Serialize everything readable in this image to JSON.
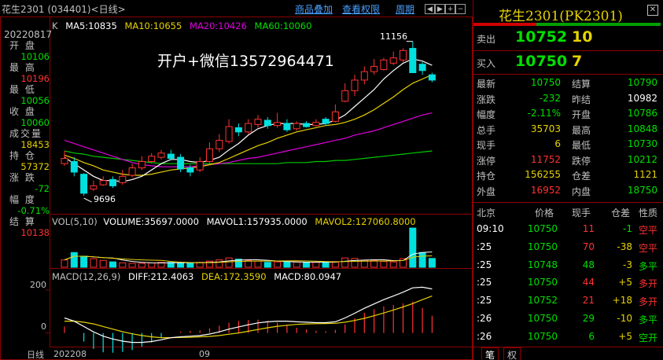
{
  "header": {
    "title": "花生2301 (034401)<日线>",
    "menu": [
      "商品叠加",
      "查看权限",
      "周期"
    ]
  },
  "left_info": {
    "date": "20220817",
    "rows": [
      {
        "label": "开 盘",
        "value": "10106",
        "color": "#00e000"
      },
      {
        "label": "最 高",
        "value": "10196",
        "color": "#ff3232"
      },
      {
        "label": "最 低",
        "value": "10056",
        "color": "#00e000"
      },
      {
        "label": "收 盘",
        "value": "10060",
        "color": "#00e000"
      },
      {
        "label": "成交量",
        "value": "18453",
        "color": "#e7d200"
      },
      {
        "label": "持 仓",
        "value": "57372",
        "color": "#e7d200"
      },
      {
        "label": "涨 跌",
        "value": "-72",
        "color": "#00e000"
      },
      {
        "label": "幅 度",
        "value": "-0.71%",
        "color": "#00e000"
      },
      {
        "label": "结 算",
        "value": "10138",
        "color": "#ff3232"
      }
    ]
  },
  "kline": {
    "label": "K",
    "ma5": "MA5:10835",
    "ma10": "MA10:10655",
    "ma20": "MA20:10426",
    "ma60": "MA60:10060",
    "watermark": "开户+微信13572964471",
    "high_marker": "11156",
    "low_marker": "9696"
  },
  "volume": {
    "label": "VOL(5,10)",
    "volume": "VOLUME:35697.0000",
    "mavol1": "MAVOL1:157935.0000",
    "mavol2": "MAVOL2:127060.8000"
  },
  "macd": {
    "label": "MACD(12,26,9)",
    "diff": "DIFF:212.4063",
    "dea": "DEA:172.3590",
    "macd": "MACD:80.0947",
    "axis": [
      "200",
      "0"
    ]
  },
  "footer": {
    "period": "日线",
    "dates": [
      "202208",
      "09"
    ]
  },
  "quote": {
    "title": "花生2301(PK2301)",
    "ask": {
      "label": "卖出",
      "price": "10752",
      "volume": "10"
    },
    "bid": {
      "label": "买入",
      "price": "10750",
      "volume": "7"
    },
    "grid": [
      [
        {
          "label": "最新",
          "value": "10750",
          "color": "#00e000"
        },
        {
          "label": "结算",
          "value": "10790",
          "color": "#00e000"
        }
      ],
      [
        {
          "label": "涨跌",
          "value": "-232",
          "color": "#00e000"
        },
        {
          "label": "昨结",
          "value": "10982",
          "color": "#ffffff"
        }
      ],
      [
        {
          "label": "幅度",
          "value": "-2.11%",
          "color": "#00e000"
        },
        {
          "label": "开盘",
          "value": "10786",
          "color": "#00e000"
        }
      ],
      [
        {
          "label": "总手",
          "value": "35703",
          "color": "#e7d200"
        },
        {
          "label": "最高",
          "value": "10848",
          "color": "#00e000"
        }
      ],
      [
        {
          "label": "现手",
          "value": "6",
          "color": "#e7d200"
        },
        {
          "label": "最低",
          "value": "10730",
          "color": "#00e000"
        }
      ],
      [
        {
          "label": "涨停",
          "value": "11752",
          "color": "#ff3232"
        },
        {
          "label": "跌停",
          "value": "10212",
          "color": "#00e000"
        }
      ],
      [
        {
          "label": "持仓",
          "value": "156255",
          "color": "#e7d200"
        },
        {
          "label": "仓差",
          "value": "1121",
          "color": "#e7d200"
        }
      ],
      [
        {
          "label": "外盘",
          "value": "16952",
          "color": "#ff3232"
        },
        {
          "label": "内盘",
          "value": "18750",
          "color": "#00e000"
        }
      ]
    ]
  },
  "ticks": {
    "headers": [
      "北京",
      "价格",
      "现手",
      "仓差",
      "性质"
    ],
    "rows": [
      {
        "time": "09:10",
        "price": "10750",
        "hand": "11",
        "oi": "-1",
        "nature": "空平",
        "price_color": "#00e000",
        "hand_color": "#ff3232",
        "oi_color": "#00e000",
        "nature_color": "#ff3232"
      },
      {
        "time": ":25",
        "price": "10750",
        "hand": "70",
        "oi": "-38",
        "nature": "空平",
        "price_color": "#00e000",
        "hand_color": "#ff3232",
        "oi_color": "#e7d200",
        "nature_color": "#ff3232"
      },
      {
        "time": ":25",
        "price": "10748",
        "hand": "48",
        "oi": "-3",
        "nature": "多平",
        "price_color": "#00e000",
        "hand_color": "#00e000",
        "oi_color": "#e7d200",
        "nature_color": "#00e000"
      },
      {
        "time": ":25",
        "price": "10750",
        "hand": "44",
        "oi": "+5",
        "nature": "多开",
        "price_color": "#00e000",
        "hand_color": "#ff3232",
        "oi_color": "#e7d200",
        "nature_color": "#ff3232"
      },
      {
        "time": ":25",
        "price": "10752",
        "hand": "21",
        "oi": "+18",
        "nature": "多开",
        "price_color": "#00e000",
        "hand_color": "#ff3232",
        "oi_color": "#e7d200",
        "nature_color": "#ff3232"
      },
      {
        "time": ":26",
        "price": "10750",
        "hand": "29",
        "oi": "-10",
        "nature": "多平",
        "price_color": "#00e000",
        "hand_color": "#00e000",
        "oi_color": "#e7d200",
        "nature_color": "#00e000"
      },
      {
        "time": ":26",
        "price": "10750",
        "hand": "6",
        "oi": "+5",
        "nature": "空开",
        "price_color": "#00e000",
        "hand_color": "#00e000",
        "oi_color": "#e7d200",
        "nature_color": "#00e000"
      }
    ]
  },
  "tabs": [
    "笔",
    "权"
  ],
  "chart_data": {
    "type": "candlestick",
    "price_range": [
      9600,
      11250
    ],
    "candles": [
      {
        "o": 10000,
        "c": 10050,
        "h": 10120,
        "l": 9980
      },
      {
        "o": 10020,
        "c": 9920,
        "h": 10060,
        "l": 9880
      },
      {
        "o": 9900,
        "c": 9720,
        "h": 9910,
        "l": 9696
      },
      {
        "o": 9760,
        "c": 9790,
        "h": 9840,
        "l": 9740
      },
      {
        "o": 9800,
        "c": 9840,
        "h": 9880,
        "l": 9790
      },
      {
        "o": 9850,
        "c": 9790,
        "h": 9880,
        "l": 9770
      },
      {
        "o": 9820,
        "c": 9880,
        "h": 9940,
        "l": 9800
      },
      {
        "o": 9890,
        "c": 9960,
        "h": 10000,
        "l": 9870
      },
      {
        "o": 9960,
        "c": 10020,
        "h": 10070,
        "l": 9940
      },
      {
        "o": 10020,
        "c": 10070,
        "h": 10100,
        "l": 10000
      },
      {
        "o": 10060,
        "c": 10100,
        "h": 10130,
        "l": 10040
      },
      {
        "o": 10090,
        "c": 10050,
        "h": 10130,
        "l": 10030
      },
      {
        "o": 10060,
        "c": 9950,
        "h": 10090,
        "l": 9920
      },
      {
        "o": 9960,
        "c": 9920,
        "h": 9990,
        "l": 9880
      },
      {
        "o": 9940,
        "c": 10020,
        "h": 10060,
        "l": 9920
      },
      {
        "o": 10020,
        "c": 10140,
        "h": 10200,
        "l": 10000
      },
      {
        "o": 10140,
        "c": 10220,
        "h": 10280,
        "l": 10110
      },
      {
        "o": 10210,
        "c": 10350,
        "h": 10420,
        "l": 10190
      },
      {
        "o": 10340,
        "c": 10300,
        "h": 10380,
        "l": 10260
      },
      {
        "o": 10300,
        "c": 10380,
        "h": 10420,
        "l": 10280
      },
      {
        "o": 10370,
        "c": 10420,
        "h": 10460,
        "l": 10340
      },
      {
        "o": 10410,
        "c": 10360,
        "h": 10440,
        "l": 10330
      },
      {
        "o": 10360,
        "c": 10390,
        "h": 10480,
        "l": 10340
      },
      {
        "o": 10380,
        "c": 10320,
        "h": 10420,
        "l": 10300
      },
      {
        "o": 10330,
        "c": 10380,
        "h": 10400,
        "l": 10310
      },
      {
        "o": 10380,
        "c": 10350,
        "h": 10400,
        "l": 10340
      },
      {
        "o": 10360,
        "c": 10390,
        "h": 10420,
        "l": 10350
      },
      {
        "o": 10420,
        "c": 10380,
        "h": 10440,
        "l": 10360
      },
      {
        "o": 10400,
        "c": 10490,
        "h": 10560,
        "l": 10390
      },
      {
        "o": 10590,
        "c": 10690,
        "h": 10760,
        "l": 10580
      },
      {
        "o": 10690,
        "c": 10790,
        "h": 10840,
        "l": 10640
      },
      {
        "o": 10790,
        "c": 10870,
        "h": 10920,
        "l": 10750
      },
      {
        "o": 10870,
        "c": 10920,
        "h": 10990,
        "l": 10840
      },
      {
        "o": 10890,
        "c": 10980,
        "h": 11000,
        "l": 10880
      },
      {
        "o": 10950,
        "c": 11000,
        "h": 11060,
        "l": 10930
      },
      {
        "o": 10980,
        "c": 11070,
        "h": 11090,
        "l": 10960
      },
      {
        "o": 11090,
        "c": 10860,
        "h": 11156,
        "l": 10860
      },
      {
        "o": 10940,
        "c": 10880,
        "h": 10960,
        "l": 10840
      },
      {
        "o": 10840,
        "c": 10790,
        "h": 10860,
        "l": 10770
      }
    ],
    "ma5": [
      10060,
      10000,
      9940,
      9880,
      9840,
      9840,
      9830,
      9850,
      9880,
      9940,
      10000,
      10040,
      10040,
      10020,
      10010,
      10030,
      10060,
      10130,
      10190,
      10270,
      10330,
      10360,
      10380,
      10380,
      10380,
      10370,
      10370,
      10380,
      10410,
      10460,
      10540,
      10620,
      10700,
      10800,
      10880,
      10950,
      10990,
      10970,
      10930
    ],
    "ma10": [
      10080,
      10050,
      10010,
      9980,
      9940,
      9920,
      9900,
      9890,
      9890,
      9900,
      9920,
      9940,
      9950,
      9960,
      9970,
      9990,
      10010,
      10050,
      10090,
      10130,
      10170,
      10200,
      10240,
      10270,
      10300,
      10320,
      10340,
      10360,
      10370,
      10390,
      10420,
      10460,
      10510,
      10570,
      10630,
      10700,
      10760,
      10800,
      10840
    ],
    "ma20": [
      10220,
      10190,
      10160,
      10130,
      10100,
      10070,
      10040,
      10010,
      9990,
      9980,
      9970,
      9970,
      9970,
      9970,
      9980,
      9990,
      10000,
      10010,
      10030,
      10050,
      10060,
      10080,
      10100,
      10120,
      10140,
      10160,
      10180,
      10200,
      10220,
      10240,
      10270,
      10290,
      10310,
      10340,
      10370,
      10400,
      10430,
      10460,
      10480
    ],
    "ma60": [
      10120,
      10100,
      10090,
      10070,
      10060,
      10050,
      10040,
      10030,
      10020,
      10010,
      10000,
      10000,
      10000,
      10000,
      10000,
      10000,
      10000,
      10000,
      10000,
      10000,
      10000,
      10000,
      10000,
      10010,
      10010,
      10010,
      10020,
      10020,
      10030,
      10030,
      10040,
      10050,
      10060,
      10070,
      10080,
      10090,
      10100,
      10110,
      10120
    ],
    "volume": [
      30,
      60,
      45,
      35,
      28,
      22,
      18,
      16,
      16,
      18,
      20,
      20,
      17,
      17,
      20,
      25,
      30,
      38,
      33,
      27,
      25,
      20,
      22,
      21,
      21,
      20,
      20,
      21,
      23,
      38,
      36,
      28,
      27,
      24,
      22,
      35,
      160,
      60,
      36
    ],
    "volume_range": [
      0,
      170
    ],
    "macd_range": [
      -60,
      240
    ],
    "diff": [
      70,
      55,
      30,
      5,
      -15,
      -28,
      -38,
      -44,
      -44,
      -40,
      -32,
      -22,
      -18,
      -15,
      -12,
      -5,
      5,
      18,
      28,
      38,
      47,
      52,
      55,
      55,
      52,
      50,
      48,
      48,
      52,
      70,
      92,
      115,
      135,
      155,
      172,
      190,
      210,
      213,
      205
    ],
    "dea": [
      55,
      55,
      50,
      42,
      30,
      18,
      6,
      -4,
      -12,
      -18,
      -22,
      -22,
      -21,
      -20,
      -18,
      -16,
      -12,
      -6,
      0,
      8,
      16,
      24,
      31,
      36,
      40,
      42,
      43,
      44,
      45,
      50,
      58,
      68,
      80,
      93,
      107,
      121,
      137,
      155,
      172
    ],
    "hist": [
      30,
      0,
      -40,
      -74,
      -90,
      -92,
      -88,
      -80,
      -64,
      -44,
      -20,
      0,
      6,
      10,
      12,
      22,
      34,
      48,
      56,
      60,
      62,
      56,
      48,
      38,
      24,
      16,
      10,
      8,
      14,
      40,
      68,
      94,
      110,
      124,
      130,
      138,
      146,
      116,
      80
    ]
  }
}
